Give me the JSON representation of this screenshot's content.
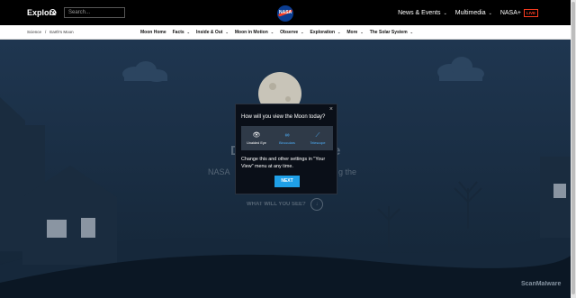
{
  "header": {
    "explore_label": "Explore",
    "search_placeholder": "Search...",
    "logo_text": "NASA",
    "links": [
      {
        "label": "News & Events"
      },
      {
        "label": "Multimedia"
      },
      {
        "label": "NASA+"
      }
    ],
    "live_badge": "LIVE"
  },
  "breadcrumb": [
    "Science",
    "/",
    "Earth's Moon"
  ],
  "subnav": [
    {
      "label": "Moon Home"
    },
    {
      "label": "Facts"
    },
    {
      "label": "Inside & Out"
    },
    {
      "label": "Moon in Motion"
    },
    {
      "label": "Observe"
    },
    {
      "label": "Exploration"
    },
    {
      "label": "More"
    },
    {
      "label": "The Solar System"
    }
  ],
  "hero": {
    "title_fragment_left": "D",
    "title_fragment_right": "e",
    "subtitle_left": "NASA",
    "subtitle_right": "g the",
    "cta": "WHAT WILL YOU SEE?"
  },
  "modal": {
    "question": "How will you view the Moon today?",
    "options": [
      {
        "label": "Unaided Eye",
        "icon": "eye-icon",
        "selected": true
      },
      {
        "label": "Binoculars",
        "icon": "binoculars-icon",
        "selected": false
      },
      {
        "label": "Telescope",
        "icon": "telescope-icon",
        "selected": false
      }
    ],
    "message": "Change this and other settings in \"Your View\" menu at any time.",
    "next_label": "NEXT",
    "close_label": "×"
  },
  "watermark": "ScanMalware",
  "colors": {
    "accent": "#1fa0e8",
    "nasa_blue": "#0b3d91",
    "nasa_red": "#fc3d21",
    "sky": "#1c3045"
  }
}
